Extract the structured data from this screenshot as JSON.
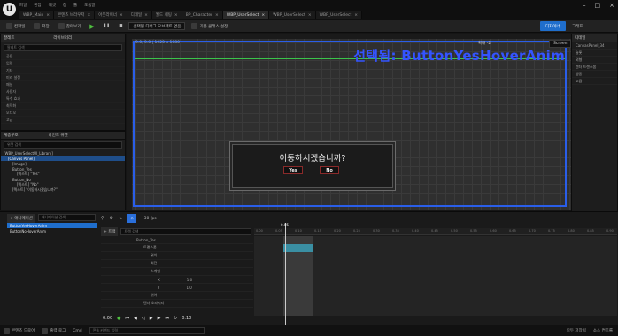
{
  "app": {
    "logo": "U"
  },
  "menu": [
    "파일",
    "편집",
    "에셋",
    "창",
    "툴",
    "도움말"
  ],
  "tabs": [
    {
      "label": "WBP_Main",
      "active": false
    },
    {
      "label": "콘텐츠 브라우저",
      "active": false
    },
    {
      "label": "아웃라이너",
      "active": false
    },
    {
      "label": "디테일",
      "active": false
    },
    {
      "label": "월드 세팅",
      "active": false
    },
    {
      "label": "BP_Character",
      "active": false
    },
    {
      "label": "WBP_UserSelect",
      "active": true
    },
    {
      "label": "WBP_UserSelect",
      "active": false
    },
    {
      "label": "WBP_UserSelect",
      "active": false
    }
  ],
  "toolbar": {
    "compile": "컴파일",
    "save": "저장",
    "browse": "찾아보기",
    "debug_dropdown": "선택된 디버그 오브젝트 없음",
    "parent": "기본 클래스 설정",
    "designer": "디자이너",
    "graph": "그래프"
  },
  "palette": {
    "title": "팔레트",
    "library": "라이브러리",
    "search_placeholder": "팔레트 검색",
    "items": [
      "공용",
      "입력",
      "기타",
      "미리 설정",
      "패널",
      "사용자",
      "특수 효과",
      "최적화",
      "오디오",
      "고급"
    ]
  },
  "hierarchy": {
    "title": "계층구조",
    "bind": "바인드 위젯",
    "search_placeholder": "위젯 검색",
    "nodes": [
      "[WBP_UserSelectUI_Library]",
      "[Canvas Panel]",
      "[Image]",
      "Button_Yes",
      "[텍스트] \"Yes\"",
      "Button_No",
      "[텍스트] \"No\"",
      "[텍스트] \"이동하시겠습니까?\""
    ]
  },
  "canvas": {
    "coords": "0.0, 0.0 | 1920 x 1080",
    "zoom": "확대 -2",
    "screen": "Screen",
    "selected_label": "선택됨: ButtonYesHoverAnim"
  },
  "dialog": {
    "question": "이동하시겠습니까?",
    "yes": "Yes",
    "no": "No"
  },
  "details": {
    "title": "디테일",
    "widget_name": "CanvasPanel_34",
    "sections": [
      "슬롯",
      "외형",
      "렌더 트랜스폼",
      "행동",
      "고급"
    ]
  },
  "animations": {
    "add": "+ 애니메이션",
    "search_placeholder": "애니메이션 검색",
    "items": [
      {
        "label": "ButtonYesHoverAnim",
        "selected": true
      },
      {
        "label": "ButtonNoHoverAnim",
        "selected": false
      }
    ]
  },
  "sequencer": {
    "fps": "30 fps",
    "track_button": "+ 트랙",
    "search_placeholder": "트랙 검색",
    "time": "0.00",
    "tracks": [
      {
        "label": "Button_Yes",
        "indent": 0
      },
      {
        "label": "트랜스폼",
        "indent": 1
      },
      {
        "label": "위치",
        "indent": 2
      },
      {
        "label": "회전",
        "indent": 2
      },
      {
        "label": "스케일",
        "indent": 2
      },
      {
        "label": "X",
        "indent": 3,
        "value": "1.0"
      },
      {
        "label": "Y",
        "indent": 3,
        "value": "1.0"
      },
      {
        "label": "쉬어",
        "indent": 2
      },
      {
        "label": "렌더 오파시티",
        "indent": 1
      }
    ],
    "end_value": "0.10",
    "ticks": [
      "0.00",
      "0.05",
      "0.10",
      "0.15",
      "0.20",
      "0.25",
      "0.30",
      "0.35",
      "0.40",
      "0.45",
      "0.50",
      "0.55",
      "0.60",
      "0.65",
      "0.70",
      "0.75",
      "0.80",
      "0.85",
      "0.90"
    ],
    "playhead": "0.05"
  },
  "statusbar": {
    "content_drawer": "콘텐츠 드로어",
    "output": "출력 로그",
    "cmd": "Cmd",
    "cmd_placeholder": "콘솔 커맨드 입력",
    "source": "소스 컨트롤",
    "unsaved": "모두 저장됨"
  }
}
